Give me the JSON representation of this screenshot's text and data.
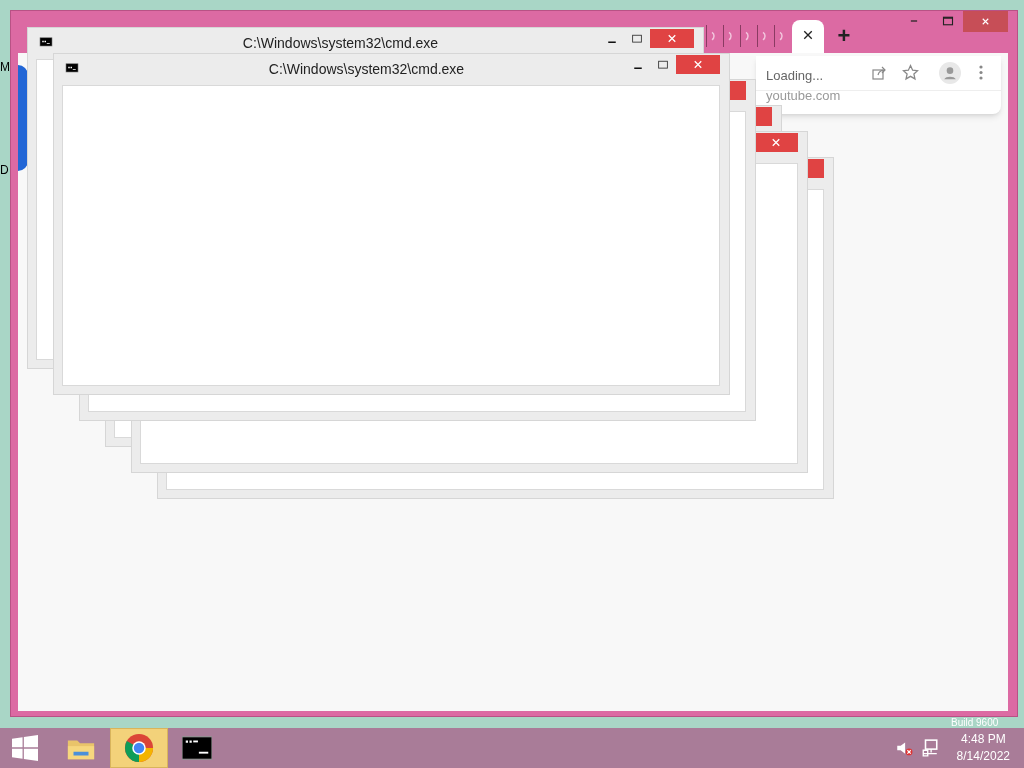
{
  "desktop": {
    "icon_labels": [
      "M",
      "D"
    ],
    "watermark": "Build 9600"
  },
  "browser": {
    "tabs": [
      {
        "kind": "loading",
        "selected": false
      },
      {
        "kind": "loading",
        "selected": false
      },
      {
        "kind": "loading",
        "selected": false
      },
      {
        "kind": "loading",
        "selected": false
      },
      {
        "kind": "loading",
        "selected": false
      },
      {
        "kind": "page",
        "selected": true
      }
    ],
    "new_tab": "+",
    "omnibox_suggestion": {
      "title": "Loading...",
      "url": "youtube.com"
    }
  },
  "cmd_windows": [
    {
      "kind": "titled",
      "title": "C:\\Windows\\system32\\cmd.exe"
    },
    {
      "kind": "titled",
      "title": "C:\\Windows\\system32\\cmd.exe"
    },
    {
      "kind": "covered"
    },
    {
      "kind": "covered"
    },
    {
      "kind": "close_visible"
    },
    {
      "kind": "covered"
    }
  ],
  "taskbar": {
    "apps": [
      {
        "kind": "explorer",
        "selected": false
      },
      {
        "kind": "chrome",
        "selected": true
      },
      {
        "kind": "cmd",
        "selected": false
      }
    ],
    "tray": {
      "volume_muted": true,
      "time": "4:48 PM",
      "date": "8/14/2022"
    }
  }
}
